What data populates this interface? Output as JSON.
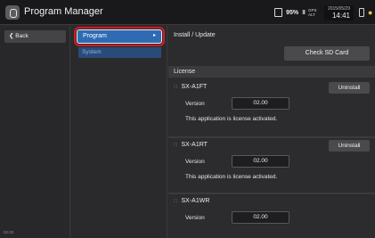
{
  "app": {
    "title": "Program Manager",
    "icon": "program-manager-icon"
  },
  "status": {
    "battery": "95%",
    "signal": "III",
    "gps": "GPS ALT",
    "date": "2015/05/29",
    "time": "14:41"
  },
  "nav": {
    "back_label": "Back",
    "footer": "02.00"
  },
  "menu": {
    "program_label": "Program",
    "program_chevron": "▸",
    "system_label": "System"
  },
  "content": {
    "title": "Install / Update",
    "check_sd_label": "Check SD Card",
    "license_header": "License",
    "version_label": "Version",
    "items": [
      {
        "name": "SX-A1FT",
        "version": "02.00",
        "status": "This application is license activated.",
        "uninstall_label": "Uninstall"
      },
      {
        "name": "SX-A1RT",
        "version": "02.00",
        "status": "This application is license activated.",
        "uninstall_label": "Uninstall"
      },
      {
        "name": "SX-A1WR",
        "version": "02.00"
      }
    ]
  },
  "colors": {
    "selected_menu": "#2f6ab5",
    "highlight_ring": "#d71a21",
    "background": "#2c2c2e"
  }
}
